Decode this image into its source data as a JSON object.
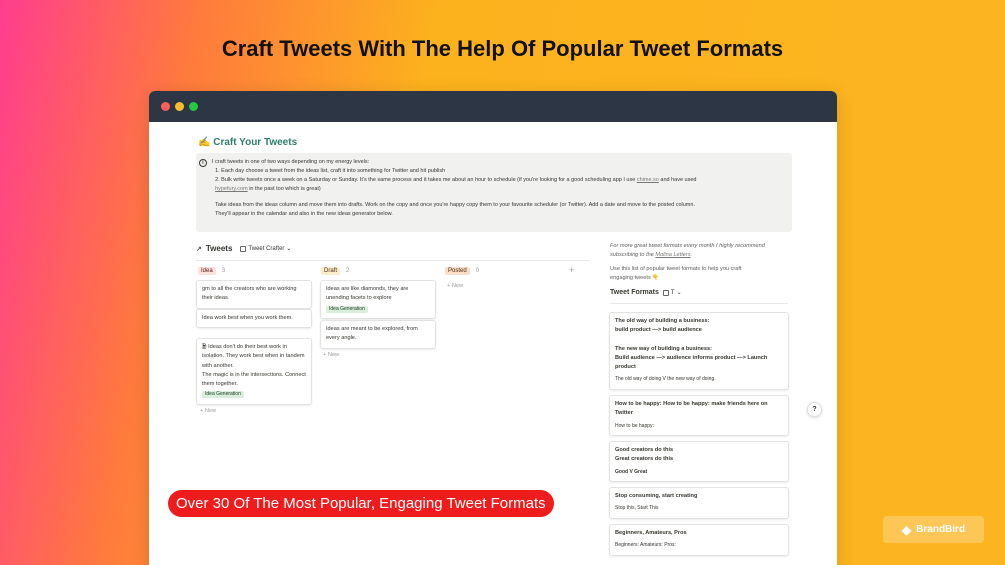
{
  "headline": "Craft Tweets With The Help Of Popular Tweet Formats",
  "page": {
    "title": "✍️ Craft Your Tweets",
    "callout": {
      "icon": "info-icon",
      "lines": [
        "I craft tweets in one of two ways depending on my energy levels:",
        "1. Each day choose a tweet from the ideas list, craft it into something for Twitter and hit publish",
        "2. Bulk write tweets once a week on a Saturday or Sunday.  It's the same process and it takes me about an hour to schedule (if you're looking for a good scheduling app I use",
        "chime.so",
        "and have used",
        "hypefury.com",
        "in the past too which is great)",
        "Take ideas from the ideas column and move them into drafts. Work on the copy and once you're happy copy them to your favourite scheduler (or Twitter). Add a date and move to the posted column.",
        "They'll appear in the calendar and also in the new ideas generator below."
      ]
    }
  },
  "board": {
    "arrow": "↗",
    "title": "Tweets",
    "view_label": "Tweet Crafter",
    "add_group": "+",
    "columns": [
      {
        "label": "Idea",
        "count": "3",
        "tag_bg": "#ffe2dd",
        "tag_fg": "#5d1715",
        "cards": [
          {
            "text": "gm to all the creators who are working their ideas."
          },
          {
            "text": "Idea work best when you work them."
          },
          {
            "text": "Ideas don't do their best work in isolation. They work best when in tandem with another.",
            "text2": "The magic is in the intersections. Connect them together.",
            "badge": "Idea Generation"
          }
        ],
        "new_label": "+ New"
      },
      {
        "label": "Draft",
        "count": "2",
        "tag_bg": "#fdecc8",
        "tag_fg": "#402c1b",
        "cards": [
          {
            "text": "Ideas are like diamonds, they are unending facets to explore",
            "badge": "Idea Generation"
          },
          {
            "text": "Ideas are meant to be explored, from every angle."
          }
        ],
        "new_label": "+ New"
      },
      {
        "label": "Posted",
        "count": "0",
        "tag_bg": "#fadec9",
        "tag_fg": "#49290e",
        "cards": [],
        "new_label": "+ New"
      }
    ]
  },
  "sidebar": {
    "recommend_1": "For more great tweet formats every month I highly recommend",
    "recommend_2": "subscribing to the",
    "recommend_link": "Molina Letters",
    "recommend_end": ".",
    "use_1": "Use this list of popular tweet formats to help you craft",
    "use_2": "engaging tweets 👇",
    "heading": "Tweet Formats",
    "heading_view": "T",
    "formats": [
      {
        "lines": [
          "The old way of building a business:",
          "build product —> build audience",
          "",
          "The new way of building a business:",
          "Build audience —> audience informs product —> Launch product"
        ],
        "foot": "The old way of doing V the new way of doing."
      },
      {
        "lines": [
          "How to be happy: How to be happy: make friends here on Twitter"
        ],
        "foot": "How to be happy:"
      },
      {
        "lines": [
          "Good creators do this",
          "Great creators do this"
        ],
        "foot": "Good V Great"
      },
      {
        "lines": [
          "Stop consuming, start creating"
        ],
        "foot": "Stop this, Start This"
      },
      {
        "lines": [
          "Beginners, Amateurs, Pros"
        ],
        "foot": "Beginners: Amateurs: Pros:"
      }
    ]
  },
  "help_label": "?",
  "banner": "Over 30 Of The Most Popular, Engaging Tweet Formats",
  "brand": {
    "logo": "brandbird-logo-icon",
    "name": "BrandBird"
  },
  "colors": {
    "titlebar": "#2d3645",
    "banner": "#ee1c1c",
    "accent_title": "#2e7d6b"
  }
}
